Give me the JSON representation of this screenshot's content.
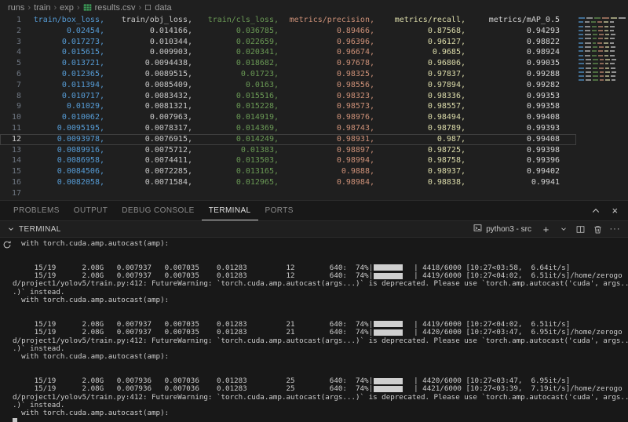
{
  "breadcrumb": {
    "items": [
      {
        "label": "runs",
        "icon": null
      },
      {
        "label": "train",
        "icon": null
      },
      {
        "label": "exp",
        "icon": null
      },
      {
        "label": "results.csv",
        "icon": "csv"
      },
      {
        "label": "data",
        "icon": "symbol"
      }
    ]
  },
  "editor": {
    "active_line": 12,
    "total_lines": 17,
    "columns": [
      {
        "name": "train/box_loss",
        "color": "#569cd6"
      },
      {
        "name": "train/obj_loss",
        "color": "#c8c8c8"
      },
      {
        "name": "train/cls_loss",
        "color": "#6a9955"
      },
      {
        "name": "metrics/precision",
        "color": "#ce9178"
      },
      {
        "name": "metrics/recall",
        "color": "#dcdcaa"
      },
      {
        "name": "metrics/mAP_0.5",
        "color": "#d4d4d4"
      }
    ],
    "rows": [
      [
        "0.02454",
        "0.014166",
        "0.036785",
        "0.89466",
        "0.87568",
        "0.94293"
      ],
      [
        "0.017273",
        "0.010344",
        "0.022659",
        "0.96396",
        "0.96127",
        "0.98822"
      ],
      [
        "0.015615",
        "0.009903",
        "0.020341",
        "0.96674",
        "0.9685",
        "0.98924"
      ],
      [
        "0.013721",
        "0.0094438",
        "0.018682",
        "0.97678",
        "0.96806",
        "0.99035"
      ],
      [
        "0.012365",
        "0.0089515",
        "0.01723",
        "0.98325",
        "0.97837",
        "0.99288"
      ],
      [
        "0.011394",
        "0.0085409",
        "0.0163",
        "0.98556",
        "0.97894",
        "0.99282"
      ],
      [
        "0.010717",
        "0.0083432",
        "0.015516",
        "0.98323",
        "0.98336",
        "0.99353"
      ],
      [
        "0.01029",
        "0.0081321",
        "0.015228",
        "0.98573",
        "0.98557",
        "0.99358"
      ],
      [
        "0.010062",
        "0.007963",
        "0.014919",
        "0.98976",
        "0.98494",
        "0.99408"
      ],
      [
        "0.0095195",
        "0.0078317",
        "0.014369",
        "0.98743",
        "0.98789",
        "0.99393"
      ],
      [
        "0.0093978",
        "0.0076915",
        "0.014249",
        "0.98931",
        "0.987",
        "0.99408"
      ],
      [
        "0.0089916",
        "0.0075712",
        "0.01383",
        "0.98897",
        "0.98725",
        "0.99398"
      ],
      [
        "0.0086958",
        "0.0074411",
        "0.013503",
        "0.98994",
        "0.98758",
        "0.99396"
      ],
      [
        "0.0084506",
        "0.0072285",
        "0.013165",
        "0.9888",
        "0.98937",
        "0.99402"
      ],
      [
        "0.0082058",
        "0.0071584",
        "0.012965",
        "0.98984",
        "0.98838",
        "0.9941"
      ]
    ]
  },
  "panel": {
    "tabs": [
      {
        "label": "PROBLEMS",
        "active": false
      },
      {
        "label": "OUTPUT",
        "active": false
      },
      {
        "label": "DEBUG CONSOLE",
        "active": false
      },
      {
        "label": "TERMINAL",
        "active": true
      },
      {
        "label": "PORTS",
        "active": false
      }
    ],
    "terminal": {
      "section_label": "TERMINAL",
      "profile": "python3 - src",
      "progress_color": "#cfcfcf",
      "lines": [
        [
          {
            "text": "  with torch.cuda.amp.autocast(amp):"
          }
        ],
        [],
        [],
        [
          {
            "text": "     15/19      2.08G   0.007937   0.007035    0.01283         12        640:  74%|"
          },
          {
            "bar": 74
          },
          {
            "text": "| 4418/6000 [10:27<03:58,  6.64it/s]"
          }
        ],
        [
          {
            "text": "     15/19      2.08G   0.007937   0.007035    0.01283         12        640:  74%|"
          },
          {
            "bar": 74
          },
          {
            "text": "| 4419/6000 [10:27<04:02,  6.51it/s]/home/zerogo"
          }
        ],
        [
          {
            "text": "d/project1/yolov5/train.py:412: FutureWarning: `torch.cuda.amp.autocast(args...)` is deprecated. Please use `torch.amp.autocast('cuda', args.."
          }
        ],
        [
          {
            "text": ".)` instead."
          }
        ],
        [
          {
            "text": "  with torch.cuda.amp.autocast(amp):"
          }
        ],
        [],
        [],
        [
          {
            "text": "     15/19      2.08G   0.007937   0.007035    0.01283         21        640:  74%|"
          },
          {
            "bar": 74
          },
          {
            "text": "| 4419/6000 [10:27<04:02,  6.51it/s]"
          }
        ],
        [
          {
            "text": "     15/19      2.08G   0.007937   0.007035    0.01283         21        640:  74%|"
          },
          {
            "bar": 74
          },
          {
            "text": "| 4420/6000 [10:27<03:47,  6.95it/s]/home/zerogo"
          }
        ],
        [
          {
            "text": "d/project1/yolov5/train.py:412: FutureWarning: `torch.cuda.amp.autocast(args...)` is deprecated. Please use `torch.amp.autocast('cuda', args.."
          }
        ],
        [
          {
            "text": ".)` instead."
          }
        ],
        [
          {
            "text": "  with torch.cuda.amp.autocast(amp):"
          }
        ],
        [],
        [],
        [
          {
            "text": "     15/19      2.08G   0.007936   0.007036    0.01283         25        640:  74%|"
          },
          {
            "bar": 74
          },
          {
            "text": "| 4420/6000 [10:27<03:47,  6.95it/s]"
          }
        ],
        [
          {
            "text": "     15/19      2.08G   0.007936   0.007036    0.01283         25        640:  74%|"
          },
          {
            "bar": 74
          },
          {
            "text": "| 4421/6000 [10:27<03:39,  7.19it/s]/home/zerogo"
          }
        ],
        [
          {
            "text": "d/project1/yolov5/train.py:412: FutureWarning: `torch.cuda.amp.autocast(args...)` is deprecated. Please use `torch.amp.autocast('cuda', args.."
          }
        ],
        [
          {
            "text": ".)` instead."
          }
        ],
        [
          {
            "text": "  with torch.cuda.amp.autocast(amp):"
          }
        ],
        [
          {
            "cursor": true
          }
        ]
      ]
    }
  }
}
